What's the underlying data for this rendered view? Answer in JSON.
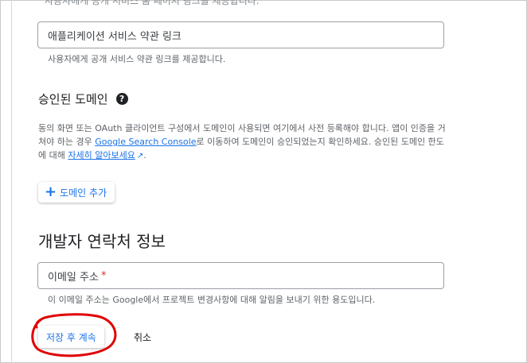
{
  "page": {
    "cut_text": "사용자에게 공개 서비스 홈 페이지 링크를 제공합니다.",
    "tos_field": {
      "placeholder": "애플리케이션 서비스 약관 링크"
    },
    "tos_helper": "사용자에게 공개 서비스 약관 링크를 제공합니다.",
    "authorized_domains": {
      "title": "승인된 도메인",
      "desc_prefix": "동의 화면 또는 OAuth 클라이언트 구성에서 도메인이 사용되면 여기에서 사전 등록해야 합니다. 앱이 인증을 거쳐야 하는 경우 ",
      "gsc_link": "Google Search Console",
      "desc_middle": "로 이동하여 도메인이 승인되었는지 확인하세요. 승인된 도메인 한도에 대해 ",
      "learn_more": "자세히 알아보세요",
      "desc_suffix": ".",
      "add_button": "도메인 추가"
    },
    "developer_contact": {
      "title": "개발자 연락처 정보",
      "email_placeholder": "이메일 주소",
      "required_mark": "*",
      "helper": "이 이메일 주소는 Google에서 프로젝트 변경사항에 대해 알림을 보내기 위한 용도입니다."
    },
    "actions": {
      "save": "저장 후 계속",
      "cancel": "취소"
    },
    "icons": {
      "help": "help-circle-icon",
      "external": "open-in-new-icon",
      "plus": "plus-icon"
    },
    "colors": {
      "accent": "#1a73e8",
      "annotation": "#e00000"
    }
  }
}
